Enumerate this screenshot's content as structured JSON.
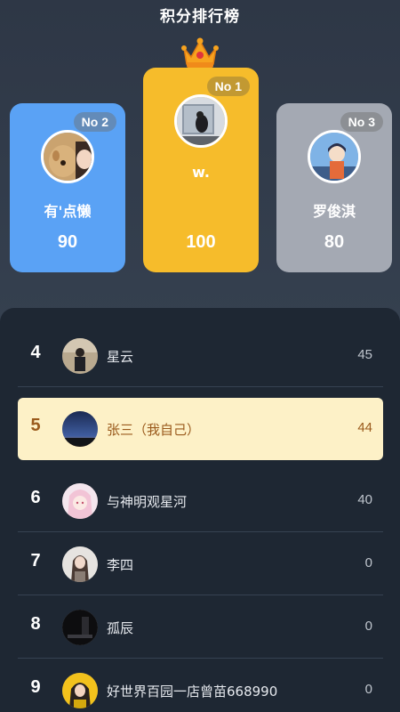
{
  "header": {
    "title": "积分排行榜"
  },
  "podium": [
    {
      "rank_label": "No 2",
      "name": "有'点懒",
      "score": "90",
      "avatar": "dog-photo-avatar"
    },
    {
      "rank_label": "No 1",
      "name": "w.",
      "score": "100",
      "avatar": "window-photo-avatar"
    },
    {
      "rank_label": "No 3",
      "name": "罗俊淇",
      "score": "80",
      "avatar": "anime-boy-avatar"
    }
  ],
  "list": [
    {
      "rank": "4",
      "name": "星云",
      "score": "45",
      "avatar": "person-photo-avatar"
    },
    {
      "rank": "5",
      "name": "张三（我自己）",
      "score": "44",
      "avatar": "night-sky-avatar",
      "is_me": true
    },
    {
      "rank": "6",
      "name": "与神明观星河",
      "score": "40",
      "avatar": "anime-girl-avatar"
    },
    {
      "rank": "7",
      "name": "李四",
      "score": "0",
      "avatar": "girl-photo-avatar"
    },
    {
      "rank": "8",
      "name": "孤辰",
      "score": "0",
      "avatar": "dark-photo-avatar"
    },
    {
      "rank": "9",
      "name": "好世界百园一店曾苗668990",
      "score": "0",
      "avatar": "yellow-photo-avatar"
    }
  ],
  "colors": {
    "second": "#5aa2f5",
    "first": "#f6bc2b",
    "third": "#a4a9b3",
    "highlight": "#fdf1c7"
  }
}
